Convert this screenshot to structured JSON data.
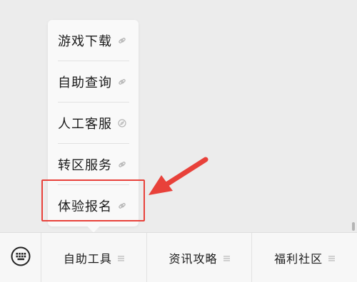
{
  "menu": {
    "items": [
      {
        "label": "游戏下载",
        "icon": "link-icon"
      },
      {
        "label": "自助查询",
        "icon": "link-icon"
      },
      {
        "label": "人工客服",
        "icon": "compass-icon"
      },
      {
        "label": "转区服务",
        "icon": "link-icon"
      },
      {
        "label": "体验报名",
        "icon": "link-icon"
      }
    ],
    "highlighted_item": "体验报名"
  },
  "bottom_bar": {
    "keyboard_icon": "keyboard-icon",
    "tabs": [
      {
        "label": "自助工具",
        "icon": "menu-icon"
      },
      {
        "label": "资讯攻略",
        "icon": "menu-icon"
      },
      {
        "label": "福利社区",
        "icon": "menu-icon"
      }
    ]
  },
  "colors": {
    "highlight": "#e8413a",
    "background": "#ececec",
    "text": "#1b1b1b"
  }
}
